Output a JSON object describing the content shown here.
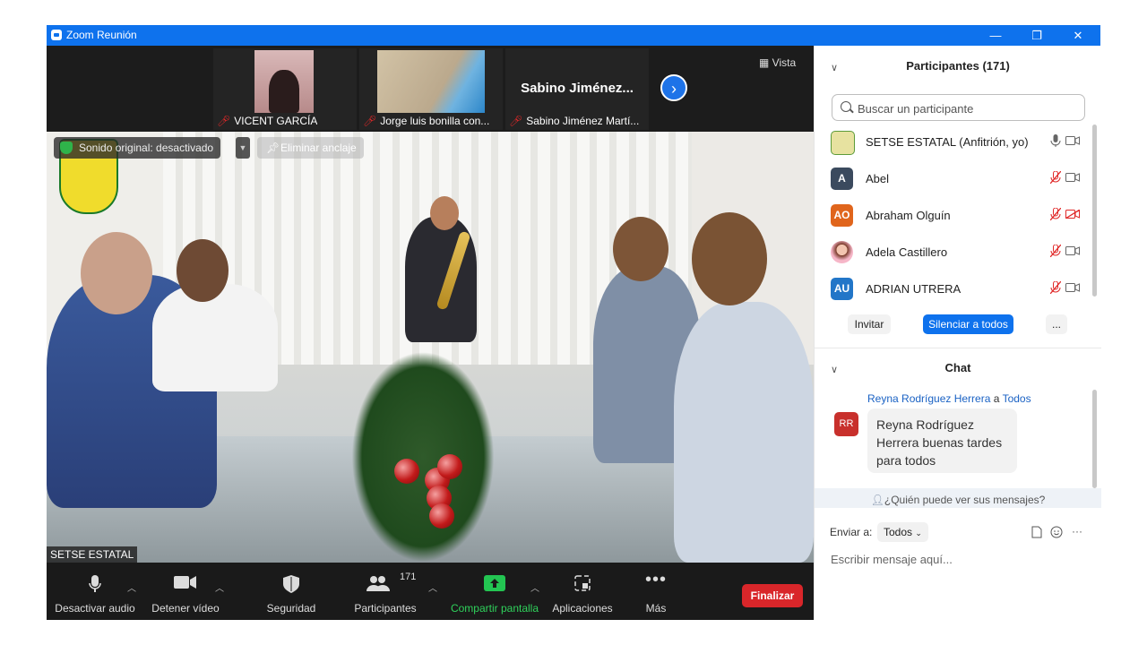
{
  "window": {
    "title": "Zoom Reunión",
    "minimize": "—",
    "restore": "❐",
    "close": "✕"
  },
  "strip": {
    "thumbs": [
      {
        "label": "VICENT GARCÍA"
      },
      {
        "label": "Jorge luis bonilla con..."
      },
      {
        "label": "Sabino Jiménez Martí...",
        "display_name": "Sabino  Jiménez..."
      }
    ],
    "next": "›",
    "view_label": "Vista"
  },
  "video": {
    "sound_label": "Sonido original: desactivado",
    "pin_label": "Eliminar anclaje",
    "speaker_name": "SETSE ESTATAL"
  },
  "toolbar": {
    "mute_label": "Desactivar audio",
    "video_label": "Detener vídeo",
    "security_label": "Seguridad",
    "participants_label": "Participantes",
    "participants_count": "171",
    "share_label": "Compartir pantalla",
    "apps_label": "Aplicaciones",
    "more_label": "Más",
    "end_label": "Finalizar"
  },
  "participants": {
    "title": "Participantes (171)",
    "search_placeholder": "Buscar un participante",
    "list": [
      {
        "name": "SETSE ESTATAL (Anfitrión, yo)",
        "initials": "",
        "color": "#e7e2a0",
        "muted": false,
        "video_off": false
      },
      {
        "name": "Abel",
        "initials": "A",
        "color": "#3b4a5e",
        "muted": true,
        "video_off": false
      },
      {
        "name": "Abraham Olguín",
        "initials": "AO",
        "color": "#e0651c",
        "muted": true,
        "video_off": true
      },
      {
        "name": "Adela Castillero",
        "initials": "",
        "color": "#f3c5b0",
        "muted": true,
        "video_off": false
      },
      {
        "name": "ADRIAN UTRERA",
        "initials": "AU",
        "color": "#2276c8",
        "muted": true,
        "video_off": false
      }
    ],
    "invite_label": "Invitar",
    "mute_all_label": "Silenciar a todos",
    "more_label": "..."
  },
  "chat": {
    "title": "Chat",
    "from_name": "Reyna Rodríguez Herrera",
    "to_word": "a",
    "to_name": "Todos",
    "avatar_initials": "RR",
    "message": "Reyna Rodríguez Herrera buenas tardes para todos",
    "who_can_see": "¿Quién puede ver sus mensajes?",
    "send_to_label": "Enviar a:",
    "send_to_value": "Todos",
    "input_placeholder": "Escribir mensaje aquí...",
    "more_label": "···"
  }
}
